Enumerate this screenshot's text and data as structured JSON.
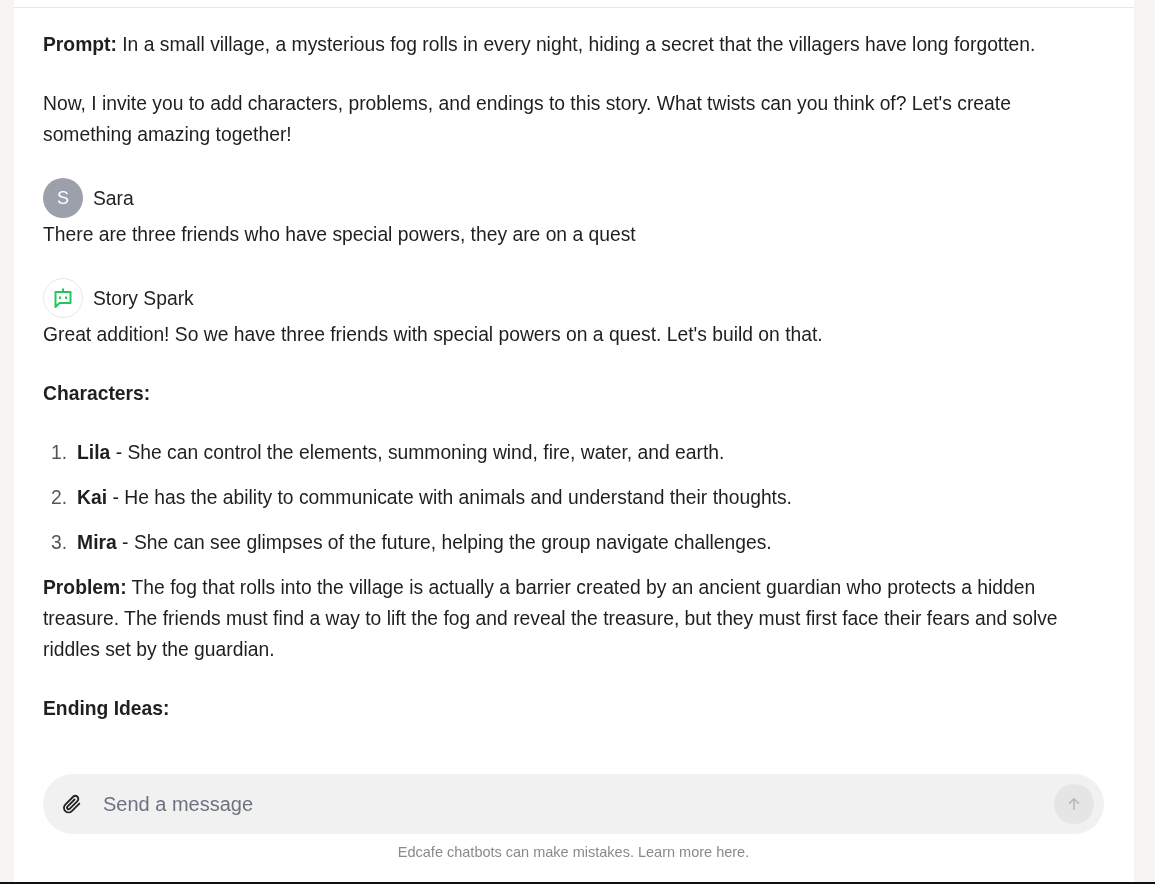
{
  "messages": [
    {
      "kind": "text",
      "blocks": [
        {
          "kind": "paragraph",
          "text": "**Prompt:** In a small village, a mysterious fog rolls in every night, hiding a secret that the villagers have long forgotten."
        },
        {
          "kind": "paragraph",
          "text": "Now, I invite you to add characters, problems, and endings to this story. What twists can you think of? Let's create something amazing together!"
        }
      ]
    },
    {
      "kind": "user",
      "author": "Sara",
      "initial": "S",
      "blocks": [
        {
          "kind": "plain",
          "text": "There are three friends who have special powers, they are on a quest"
        }
      ]
    },
    {
      "kind": "bot",
      "author": "Story Spark",
      "blocks": [
        {
          "kind": "plain",
          "text": "Great addition! So we have three friends with special powers on a quest. Let's build on that."
        },
        {
          "kind": "heading",
          "text": "Characters:"
        },
        {
          "kind": "list",
          "items": [
            {
              "number": "1.",
              "text": "**Lila** - She can control the elements, summoning wind, fire, water, and earth."
            },
            {
              "number": "2.",
              "text": "**Kai** - He has the ability to communicate with animals and understand their thoughts."
            },
            {
              "number": "3.",
              "text": "**Mira** - She can see glimpses of the future, helping the group navigate challenges."
            }
          ]
        },
        {
          "kind": "paragraph",
          "text": "**Problem:** The fog that rolls into the village is actually a barrier created by an ancient guardian who protects a hidden treasure. The friends must find a way to lift the fog and reveal the treasure, but they must first face their fears and solve riddles set by the guardian."
        },
        {
          "kind": "heading",
          "text": "Ending Ideas:"
        }
      ]
    }
  ],
  "composer": {
    "placeholder": "Send a message",
    "disclaimer": "Edcafe chatbots can make mistakes. Learn more here."
  }
}
